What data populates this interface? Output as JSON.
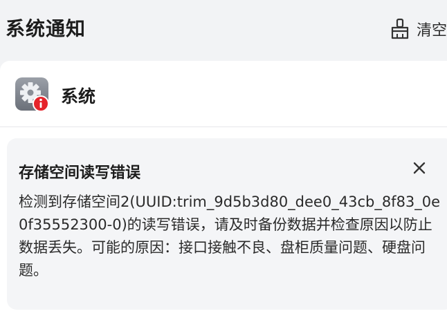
{
  "header": {
    "title": "系统通知",
    "clear_label": "清空",
    "clear_icon": "broom-icon"
  },
  "group": {
    "name": "系统",
    "icon": "system-gear-icon",
    "badge_icon": "alert-info-icon",
    "badge_color": "#e5242b"
  },
  "notification": {
    "title": "存储空间读写错误",
    "message": "检测到存储空间2(UUID:trim_9d5b3d80_dee0_43cb_8f83_0e0f35552300-0)的读写错误，请及时备份数据并检查原因以防止数据丢失。可能的原因：接口接触不良、盘柜质量问题、硬盘问题。",
    "close_icon": "close-icon"
  }
}
